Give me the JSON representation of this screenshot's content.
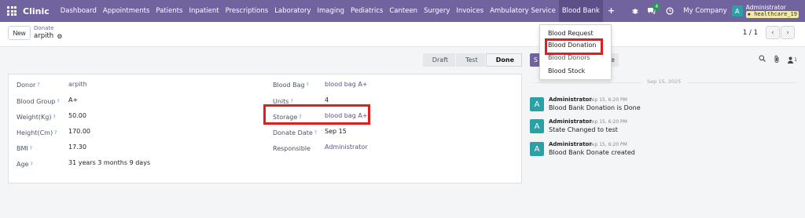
{
  "navbar": {
    "brand": "Clinic",
    "menu": [
      "Dashboard",
      "Appointments",
      "Patients",
      "Inpatient",
      "Prescriptions",
      "Laboratory",
      "Imaging",
      "Pediatrics",
      "Canteen",
      "Surgery",
      "Invoices",
      "Ambulatory Service",
      "Blood Bank"
    ],
    "plus": "+",
    "message_count": "4",
    "company": "My Company",
    "avatar_letter": "A",
    "user": "Administrator",
    "database": "healthcare_19"
  },
  "control": {
    "new_label": "New",
    "breadcrumb_parent": "Donate",
    "breadcrumb_current": "arpith",
    "pager": "1 / 1",
    "prev": "‹",
    "next": "›"
  },
  "statusbar": {
    "stages": [
      "Draft",
      "Test",
      "Done"
    ],
    "active": "Done"
  },
  "form": {
    "left": [
      {
        "label": "Donor",
        "value": "arpith"
      },
      {
        "label": "Blood Group",
        "value": "A+"
      },
      {
        "label": "Weight(Kg)",
        "value": "50.00"
      },
      {
        "label": "Height(Cm)",
        "value": "170.00"
      },
      {
        "label": "BMI",
        "value": "17.30"
      },
      {
        "label": "Age",
        "value": "31 years 3 months 9 days"
      }
    ],
    "right": [
      {
        "label": "Blood Bag",
        "value": "blood bag A+"
      },
      {
        "label": "Units",
        "value": "4"
      },
      {
        "label": "Storage",
        "value": "blood bag A+"
      },
      {
        "label": "Donate Date",
        "value": "Sep 15"
      },
      {
        "label": "Responsible",
        "value": "Administrator"
      }
    ]
  },
  "chatter": {
    "send_label": "S",
    "activity_label": "e",
    "date_separator": "Sep 15, 2025",
    "messages": [
      {
        "avatar": "A",
        "author": "Administrator",
        "time": "Sep 15, 6:20 PM",
        "body": "Blood Bank Donation is Done"
      },
      {
        "avatar": "A",
        "author": "Administrator",
        "time": "Sep 15, 6:20 PM",
        "body": "State Changed to test"
      },
      {
        "avatar": "A",
        "author": "Administrator",
        "time": "Sep 15, 6:20 PM",
        "body": "Blood Bank Donate created"
      }
    ],
    "follower_count": "1"
  },
  "dropdown": {
    "items": [
      "Blood Request",
      "Blood Donation",
      "Blood Donors",
      "Blood Stock"
    ],
    "highlighted": "Blood Donation"
  },
  "colors": {
    "navbar": "#71639e",
    "highlight_box": "#e11d1d",
    "avatar": "#2ca1a5"
  }
}
